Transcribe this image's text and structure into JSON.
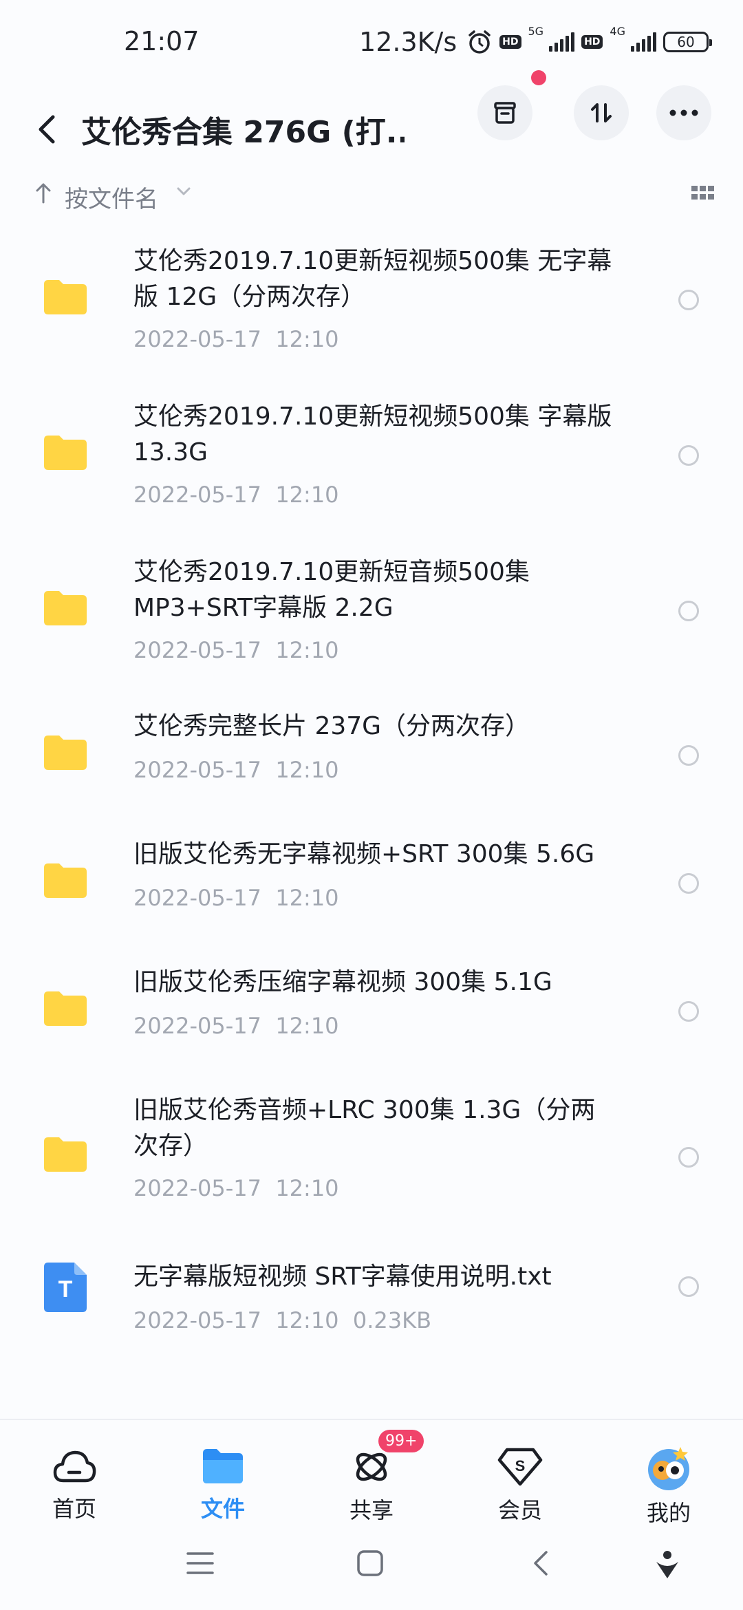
{
  "status_bar": {
    "time": "21:07",
    "net_speed": "12.3K/s",
    "icons": [
      "alarm-icon",
      "hd-icon",
      "signal-5g-icon",
      "hd-icon",
      "signal-4g-icon",
      "battery-icon"
    ],
    "sim1_network": "5G",
    "sim2_network": "4G",
    "hd_label": "HD",
    "battery": "60"
  },
  "header": {
    "title": "艾伦秀合集 276G (打...",
    "back_icon": "chevron-left-icon",
    "actions": [
      "archive-icon",
      "transfer-icon",
      "more-icon"
    ]
  },
  "sort": {
    "label": "按文件名",
    "icon": "arrow-up-icon"
  },
  "files": [
    {
      "type": "folder",
      "name_line1": "艾伦秀2019.7.10更新短视频500集 无字幕",
      "name_line2": "版 12G（分两次存）",
      "meta": "2022-05-17  12:10"
    },
    {
      "type": "folder",
      "name_line1": "艾伦秀2019.7.10更新短视频500集 字幕版",
      "name_line2": "13.3G",
      "meta": "2022-05-17  12:10"
    },
    {
      "type": "folder",
      "name_line1": "艾伦秀2019.7.10更新短音频500集",
      "name_line2": "MP3+SRT字幕版 2.2G",
      "meta": "2022-05-17  12:10"
    },
    {
      "type": "folder",
      "name_line1": "艾伦秀完整长片 237G（分两次存）",
      "name_line2": "",
      "meta": "2022-05-17  12:10"
    },
    {
      "type": "folder",
      "name_line1": "旧版艾伦秀无字幕视频+SRT 300集 5.6G",
      "name_line2": "",
      "meta": "2022-05-17  12:10"
    },
    {
      "type": "folder",
      "name_line1": "旧版艾伦秀压缩字幕视频 300集 5.1G",
      "name_line2": "",
      "meta": "2022-05-17  12:10"
    },
    {
      "type": "folder",
      "name_line1": "旧版艾伦秀音频+LRC 300集 1.3G（分两",
      "name_line2": "次存）",
      "meta": "2022-05-17  12:10"
    },
    {
      "type": "txt",
      "icon_letter": "T",
      "name_line1": "无字幕版短视频 SRT字幕使用说明.txt",
      "name_line2": "",
      "meta": "2022-05-17  12:10  0.23KB"
    }
  ],
  "nav": {
    "home": "首页",
    "files": "文件",
    "share": "共享",
    "share_badge": "99+",
    "vip": "会员",
    "vip_symbol": "S",
    "mine": "我的"
  },
  "colors": {
    "accent": "#2d8ef4",
    "folder": "#ffd544",
    "badge": "#f0436a",
    "meta_text": "#a2a7b1"
  }
}
